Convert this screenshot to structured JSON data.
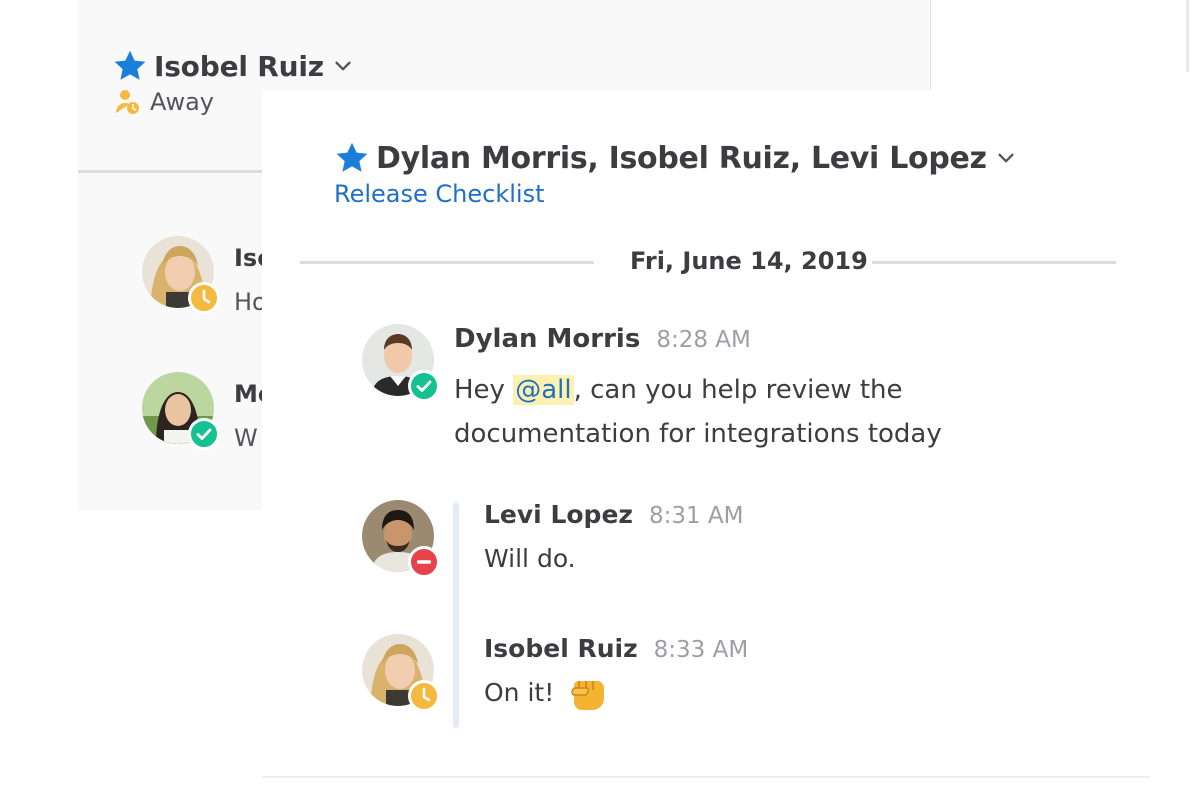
{
  "back_window": {
    "title": "Isobel Ruiz",
    "status_text": "Away",
    "messages": [
      {
        "name": "Isc",
        "text": "Ho"
      },
      {
        "name": "Mc",
        "text": "W"
      }
    ]
  },
  "front_window": {
    "title": "Dylan Morris, Isobel Ruiz, Levi Lopez",
    "subtitle": "Release Checklist",
    "date_separator": "Fri, June 14, 2019",
    "message": {
      "name": "Dylan Morris",
      "time": "8:28 AM",
      "text_before": "Hey ",
      "mention": "@all",
      "text_after": ", can you help review the documentation for integrations today"
    },
    "thread_replies": [
      {
        "name": "Levi Lopez",
        "time": "8:31 AM",
        "text": "Will do."
      },
      {
        "name": "Isobel Ruiz",
        "time": "8:33 AM",
        "text": "On it!"
      }
    ]
  },
  "colors": {
    "star": "#1b7fd9",
    "link": "#1f6fc5",
    "mention_bg": "#fcf1b0",
    "away": "#f5b940",
    "online": "#14c291",
    "dnd": "#e8424d"
  },
  "icons": {
    "star": "star-icon",
    "chevron": "chevron-down-icon",
    "away": "away-person-icon",
    "status_online": "check-circle-icon",
    "status_away": "clock-icon",
    "status_dnd": "minus-circle-icon",
    "reaction": "fist-emoji-icon"
  }
}
